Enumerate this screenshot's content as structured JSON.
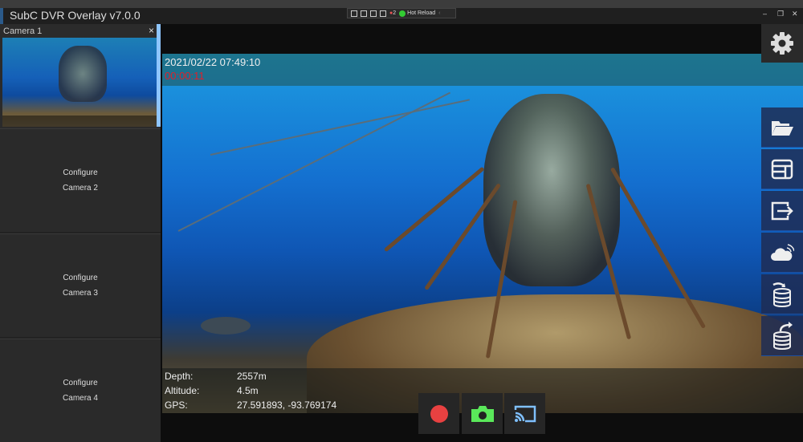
{
  "window": {
    "title": "SubC DVR Overlay v7.0.0",
    "minimize": "–",
    "maximize": "❐",
    "close": "✕"
  },
  "devbar": {
    "error_count": "2",
    "hot_reload": "Hot Reload",
    "collapse": "‹"
  },
  "sidebar": {
    "camera1": {
      "label": "Camera 1",
      "close": "×"
    },
    "panels": [
      {
        "line1": "Configure",
        "line2": "Camera 2"
      },
      {
        "line1": "Configure",
        "line2": "Camera 3"
      },
      {
        "line1": "Configure",
        "line2": "Camera 4"
      }
    ]
  },
  "overlay": {
    "datetime": "2021/02/22 07:49:10",
    "elapsed": "00:00:11",
    "telemetry": [
      {
        "label": "Depth:",
        "value": "2557m"
      },
      {
        "label": "Altitude:",
        "value": "4.5m"
      },
      {
        "label": "GPS:",
        "value": "27.591893, -93.769174"
      }
    ]
  },
  "colors": {
    "record": "#e84141",
    "snapshot": "#5ae85a",
    "cast": "#7fc0ff",
    "timer": "#e0202a"
  }
}
